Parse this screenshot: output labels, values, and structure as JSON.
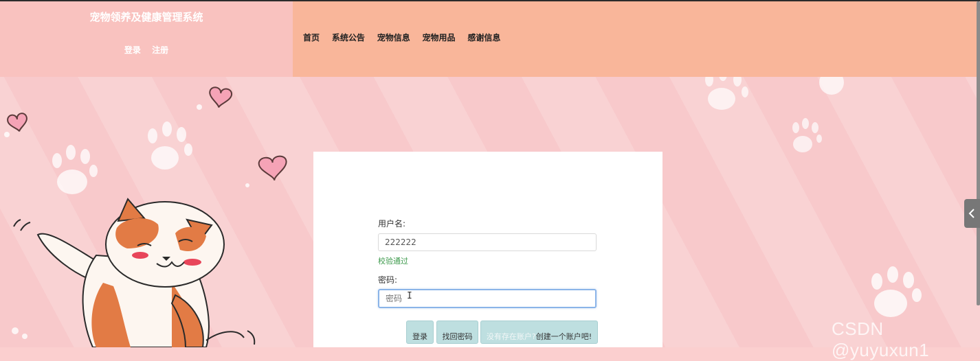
{
  "header": {
    "site_title": "宠物领养及健康管理系统",
    "auth_links": {
      "login": "登录",
      "register": "注册"
    },
    "nav": [
      "首页",
      "系统公告",
      "宠物信息",
      "宠物用品",
      "感谢信息"
    ]
  },
  "login_form": {
    "username_label": "用户名:",
    "username_value": "222222",
    "username_hint": "校验通过",
    "password_label": "密码:",
    "password_placeholder": "密码",
    "buttons": {
      "login": "登录",
      "recover_password": "找回密码",
      "register_prompt_pale": "没有存在账户?",
      "register_prompt": "创建一个账户吧!"
    }
  },
  "watermark": "CSDN @yuyuxun1",
  "colors": {
    "brand_bg": "#f9c2bf",
    "nav_bg": "#f9b69a",
    "page_bg": "#f8c9cb",
    "button_bg": "#bedfe0",
    "hint_green": "#3d9a4c",
    "focus_border": "#8ab4e8"
  },
  "icons": [
    "heart-icon",
    "paw-icon",
    "cat-illustration",
    "chevron-left-icon"
  ]
}
